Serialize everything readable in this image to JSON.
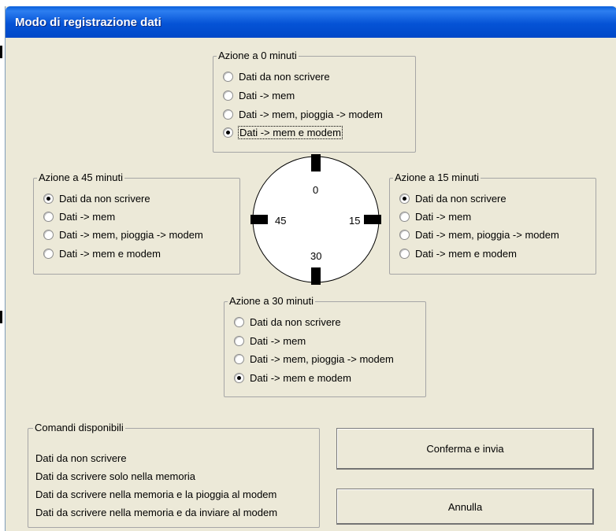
{
  "window": {
    "title": "Modo di registrazione dati"
  },
  "groups": {
    "g0": {
      "legend": "Azione a 0 minuti",
      "selected": 3
    },
    "g15": {
      "legend": "Azione a 15 minuti",
      "selected": 0
    },
    "g30": {
      "legend": "Azione a 30 minuti",
      "selected": 3
    },
    "g45": {
      "legend": "Azione a 45 minuti",
      "selected": 0
    }
  },
  "options": [
    "Dati da non scrivere",
    "Dati -> mem",
    "Dati -> mem, pioggia -> modem",
    "Dati -> mem e modem"
  ],
  "clock": {
    "n0": "0",
    "n15": "15",
    "n30": "30",
    "n45": "45"
  },
  "commands": {
    "legend": "Comandi disponibili",
    "lines": [
      "Dati da non scrivere",
      "Dati da scrivere solo nella memoria",
      "Dati da scrivere nella memoria e la pioggia al modem",
      "Dati da scrivere nella memoria e da inviare al modem"
    ]
  },
  "buttons": {
    "confirm": "Conferma e invia",
    "cancel": "Annulla"
  }
}
